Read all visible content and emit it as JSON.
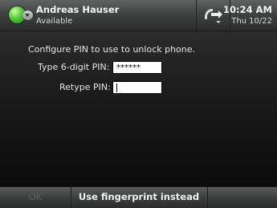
{
  "header": {
    "user_name": "Andreas Hauser",
    "presence_status": "Available",
    "presence_icon": "presence-available-icon",
    "presence_color": "#54c93a",
    "phone_icon": "phone-transfer-icon",
    "time": "10:24 AM",
    "date": "Thu 10/22"
  },
  "form": {
    "prompt": "Configure PIN to use to unlock phone.",
    "pin_label": "Type 6-digit PIN:",
    "pin_value": "******",
    "retype_label": "Retype PIN:",
    "retype_value": ""
  },
  "softkeys": {
    "ok_label": "OK",
    "fingerprint_label": "Use fingerprint instead"
  }
}
